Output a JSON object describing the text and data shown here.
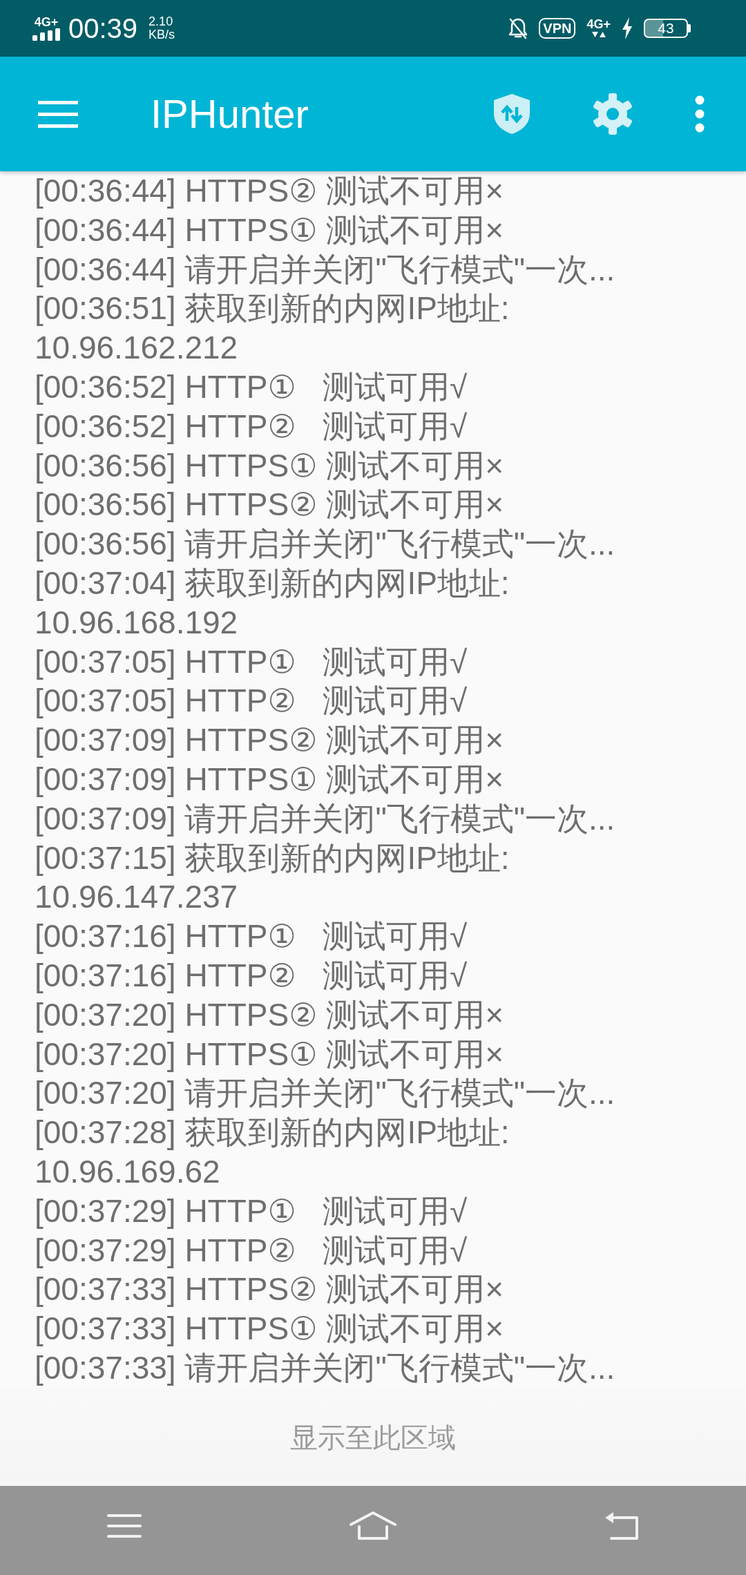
{
  "status_bar": {
    "network_left": "4G+",
    "time": "00:39",
    "speed_value": "2.10",
    "speed_unit": "KB/s",
    "vpn": "VPN",
    "network_right": "4G+",
    "battery": "43"
  },
  "app_bar": {
    "title": "IPHunter"
  },
  "log_lines": [
    "[00:36:44] HTTPS② 测试不可用×",
    "[00:36:44] HTTPS① 测试不可用×",
    "[00:36:44] 请开启并关闭\"飞行模式\"一次...",
    "[00:36:51] 获取到新的内网IP地址:",
    "10.96.162.212",
    "[00:36:52] HTTP①   测试可用√",
    "[00:36:52] HTTP②   测试可用√",
    "[00:36:56] HTTPS① 测试不可用×",
    "[00:36:56] HTTPS② 测试不可用×",
    "[00:36:56] 请开启并关闭\"飞行模式\"一次...",
    "[00:37:04] 获取到新的内网IP地址:",
    "10.96.168.192",
    "[00:37:05] HTTP①   测试可用√",
    "[00:37:05] HTTP②   测试可用√",
    "[00:37:09] HTTPS② 测试不可用×",
    "[00:37:09] HTTPS① 测试不可用×",
    "[00:37:09] 请开启并关闭\"飞行模式\"一次...",
    "[00:37:15] 获取到新的内网IP地址:",
    "10.96.147.237",
    "[00:37:16] HTTP①   测试可用√",
    "[00:37:16] HTTP②   测试可用√",
    "[00:37:20] HTTPS② 测试不可用×",
    "[00:37:20] HTTPS① 测试不可用×",
    "[00:37:20] 请开启并关闭\"飞行模式\"一次...",
    "[00:37:28] 获取到新的内网IP地址:",
    "10.96.169.62",
    "[00:37:29] HTTP①   测试可用√",
    "[00:37:29] HTTP②   测试可用√",
    "[00:37:33] HTTPS② 测试不可用×",
    "[00:37:33] HTTPS① 测试不可用×",
    "[00:37:33] 请开启并关闭\"飞行模式\"一次..."
  ],
  "footer": {
    "label": "显示至此区域"
  }
}
